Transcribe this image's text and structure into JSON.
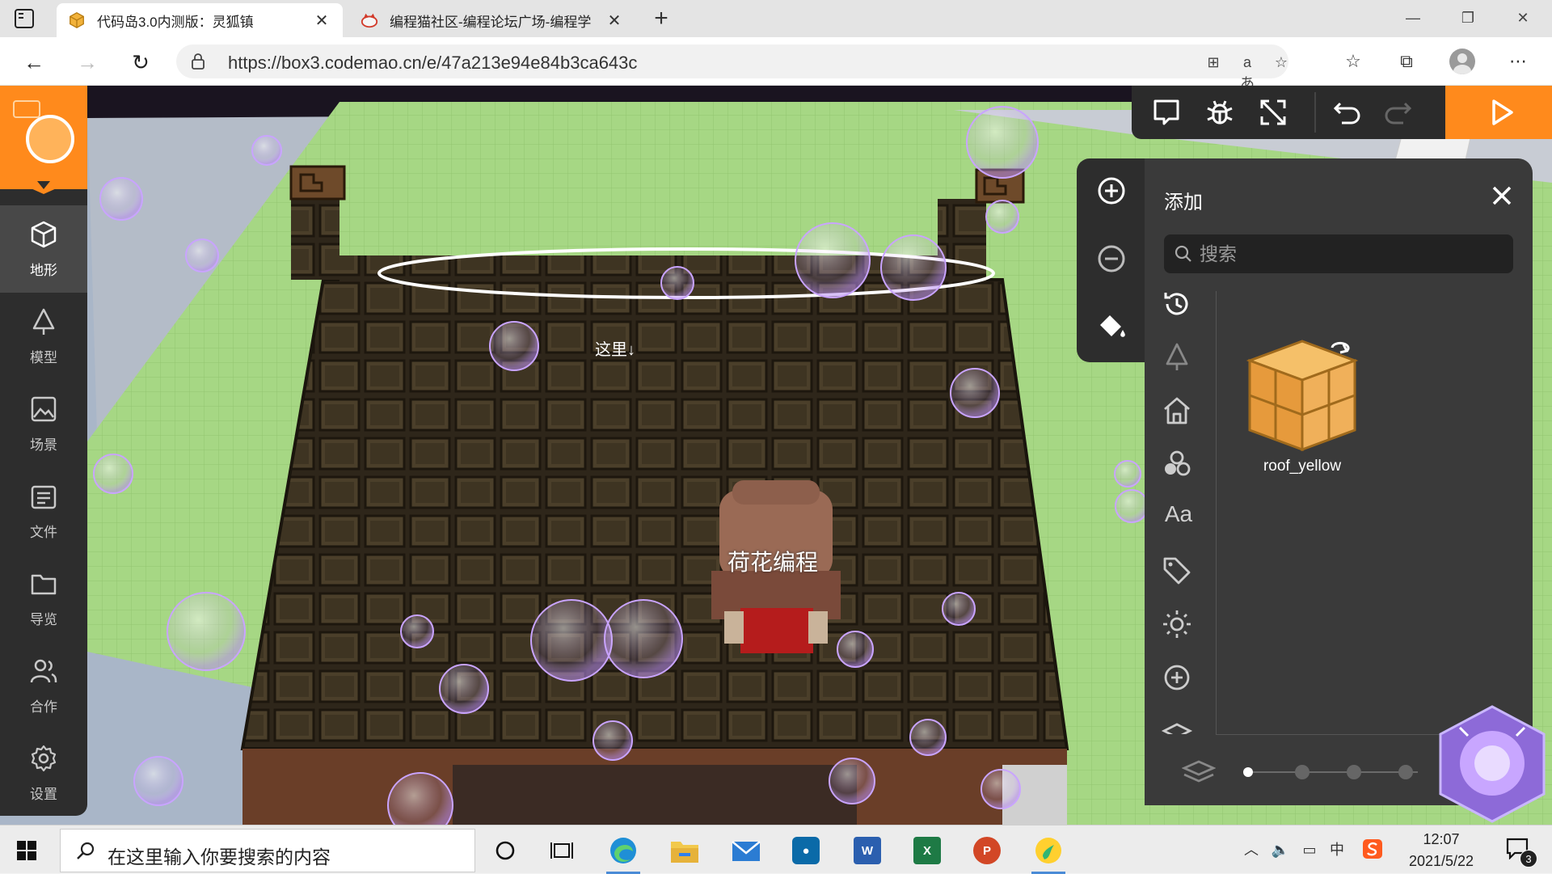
{
  "browser": {
    "tabs": [
      {
        "title": "代码岛3.0内测版：灵狐镇",
        "active": true
      },
      {
        "title": "编程猫社区-编程论坛广场-编程学",
        "active": false
      }
    ],
    "url": "https://box3.codemao.cn/e/47a213e94e84b3ca643c"
  },
  "sidebar": {
    "items": [
      {
        "label": "地形",
        "icon": "cube-icon",
        "active": true
      },
      {
        "label": "模型",
        "icon": "tree-icon",
        "active": false
      },
      {
        "label": "场景",
        "icon": "image-icon",
        "active": false
      },
      {
        "label": "文件",
        "icon": "file-icon",
        "active": false
      },
      {
        "label": "导览",
        "icon": "folder-icon",
        "active": false
      },
      {
        "label": "合作",
        "icon": "users-icon",
        "active": false
      },
      {
        "label": "设置",
        "icon": "gear-icon",
        "active": false
      }
    ]
  },
  "toolbar": {
    "tools": [
      "chat-icon",
      "debug-icon",
      "fullscreen-icon",
      "undo-icon",
      "redo-icon"
    ],
    "play": "play-icon"
  },
  "scene": {
    "here_label": "这里↓",
    "player_name": "荷花编程"
  },
  "add_panel": {
    "title": "添加",
    "search_placeholder": "搜索",
    "categories": [
      "history-icon",
      "tree-icon",
      "house-icon",
      "shapes-icon",
      "Aa",
      "tag-icon",
      "sun-icon",
      "add-circle-icon",
      "layer-icon"
    ],
    "items": [
      {
        "label": "roof_yellow"
      }
    ],
    "pagination": {
      "pages": 4,
      "current": 1
    }
  },
  "taskbar": {
    "search_text": "在这里输入你要搜索的内容",
    "apps": [
      "cortana-icon",
      "task-view-icon",
      "edge-icon",
      "explorer-icon",
      "mail-icon",
      "dell-icon",
      "word-icon",
      "excel-icon",
      "powerpoint-icon",
      "music-icon"
    ],
    "ime": "中",
    "time": "12:07",
    "date": "2021/5/22",
    "notifications": "3"
  },
  "colors": {
    "accent": "#ff8a1c",
    "panel": "#3a3a3a",
    "sidebar": "#2d2d2d",
    "grass": "#a6d784",
    "roof": "#3b3223"
  }
}
